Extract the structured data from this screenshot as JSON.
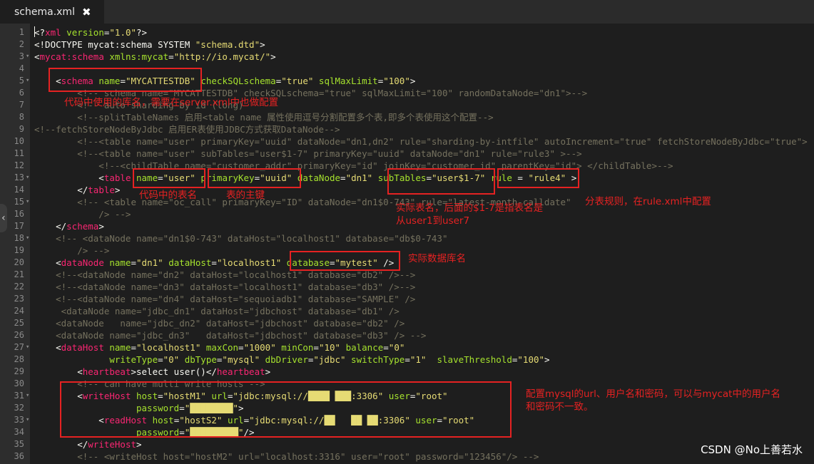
{
  "tab": {
    "title": "schema.xml",
    "close_icon": "close-icon"
  },
  "lines": [
    {
      "n": "1",
      "fold": "",
      "tokens": [
        [
          "t",
          "<?"
        ],
        [
          "tag",
          "xml"
        ],
        [
          "attr",
          " version"
        ],
        [
          "t",
          "="
        ],
        [
          "str",
          "\"1.0\""
        ],
        [
          "t",
          "?>"
        ]
      ]
    },
    {
      "n": "2",
      "fold": "",
      "tokens": [
        [
          "t",
          "<!DOCTYPE mycat:schema SYSTEM "
        ],
        [
          "str",
          "\"schema.dtd\""
        ],
        [
          "t",
          ">"
        ]
      ]
    },
    {
      "n": "3",
      "fold": "▾",
      "tokens": [
        [
          "t",
          "<"
        ],
        [
          "tag",
          "mycat:schema"
        ],
        [
          "attr",
          " xmlns:mycat"
        ],
        [
          "t",
          "="
        ],
        [
          "str",
          "\"http://io.mycat/\""
        ],
        [
          "t",
          ">"
        ]
      ]
    },
    {
      "n": "4",
      "fold": "",
      "tokens": []
    },
    {
      "n": "5",
      "fold": "▾",
      "tokens": [
        [
          "t",
          "    <"
        ],
        [
          "tag",
          "schema"
        ],
        [
          "attr",
          " name"
        ],
        [
          "t",
          "="
        ],
        [
          "str",
          "\"MYCATTESTDB\""
        ],
        [
          "attr",
          " checkSQLschema"
        ],
        [
          "t",
          "="
        ],
        [
          "str",
          "\"true\""
        ],
        [
          "attr",
          " sqlMaxLimit"
        ],
        [
          "t",
          "="
        ],
        [
          "str",
          "\"100\""
        ],
        [
          "t",
          ">"
        ]
      ]
    },
    {
      "n": "6",
      "fold": "",
      "tokens": [
        [
          "com",
          "        <!-- schema name=\"MYCATTESTDB\" checkSQLschema=\"true\" sqlMaxLimit=\"100\" randomDataNode=\"dn1\">-->"
        ]
      ]
    },
    {
      "n": "7",
      "fold": "",
      "tokens": [
        [
          "com",
          "        <!-- auto sharding by id (long)"
        ]
      ]
    },
    {
      "n": "8",
      "fold": "",
      "tokens": [
        [
          "com",
          "        <!--splitTableNames 启用<table name 属性使用逗号分割配置多个表,即多个表使用这个配置-->"
        ]
      ]
    },
    {
      "n": "9",
      "fold": "",
      "tokens": [
        [
          "com",
          "<!--fetchStoreNodeByJdbc 启用ER表使用JDBC方式获取DataNode-->"
        ]
      ]
    },
    {
      "n": "10",
      "fold": "",
      "tokens": [
        [
          "com",
          "        <!--<table name=\"user\" primaryKey=\"uuid\" dataNode=\"dn1,dn2\" rule=\"sharding-by-intfile\" autoIncrement=\"true\" fetchStoreNodeByJdbc=\"true\">"
        ]
      ]
    },
    {
      "n": "11",
      "fold": "",
      "tokens": [
        [
          "com",
          "        <!--<table name=\"user\" subTables=\"user$1-7\" primaryKey=\"uuid\" dataNode=\"dn1\" rule=\"rule3\" >-->"
        ]
      ]
    },
    {
      "n": "12",
      "fold": "",
      "tokens": [
        [
          "com",
          "            <!--<childTable name=\"customer_addr\" primaryKey=\"id\" joinKey=\"customer_id\" parentKey=\"id\"> </childTable>-->"
        ]
      ]
    },
    {
      "n": "13",
      "fold": "▾",
      "tokens": [
        [
          "t",
          "            <"
        ],
        [
          "tag",
          "table"
        ],
        [
          "attr",
          " name"
        ],
        [
          "t",
          "="
        ],
        [
          "str",
          "\"user\""
        ],
        [
          "attr",
          " primaryKey"
        ],
        [
          "t",
          "="
        ],
        [
          "str",
          "\"uuid\""
        ],
        [
          "attr",
          " dataNode"
        ],
        [
          "t",
          "="
        ],
        [
          "str",
          "\"dn1\""
        ],
        [
          "attr",
          " subTables"
        ],
        [
          "t",
          "="
        ],
        [
          "str",
          "\"user$1-7\""
        ],
        [
          "attr",
          " rule"
        ],
        [
          "t",
          " = "
        ],
        [
          "str",
          "\"rule4\""
        ],
        [
          "t",
          " >"
        ]
      ]
    },
    {
      "n": "14",
      "fold": "",
      "tokens": [
        [
          "t",
          "        </"
        ],
        [
          "tag",
          "table"
        ],
        [
          "t",
          ">"
        ]
      ]
    },
    {
      "n": "15",
      "fold": "▾",
      "tokens": [
        [
          "com",
          "        <!-- <table name=\"oc_call\" primaryKey=\"ID\" dataNode=\"dn1$0-743\" rule=\"latest-month-calldate\""
        ]
      ]
    },
    {
      "n": "16",
      "fold": "",
      "tokens": [
        [
          "com",
          "            /> -->"
        ]
      ]
    },
    {
      "n": "17",
      "fold": "",
      "tokens": [
        [
          "t",
          "    </"
        ],
        [
          "tag",
          "schema"
        ],
        [
          "t",
          ">"
        ]
      ]
    },
    {
      "n": "18",
      "fold": "▾",
      "tokens": [
        [
          "com",
          "    <!-- <dataNode name=\"dn1$0-743\" dataHost=\"localhost1\" database=\"db$0-743\""
        ]
      ]
    },
    {
      "n": "19",
      "fold": "",
      "tokens": [
        [
          "com",
          "        /> -->"
        ]
      ]
    },
    {
      "n": "20",
      "fold": "",
      "tokens": [
        [
          "t",
          "    <"
        ],
        [
          "tag",
          "dataNode"
        ],
        [
          "attr",
          " name"
        ],
        [
          "t",
          "="
        ],
        [
          "str",
          "\"dn1\""
        ],
        [
          "attr",
          " dataHost"
        ],
        [
          "t",
          "="
        ],
        [
          "str",
          "\"localhost1\""
        ],
        [
          "attr",
          " database"
        ],
        [
          "t",
          "="
        ],
        [
          "str",
          "\"mytest\""
        ],
        [
          "t",
          " />"
        ]
      ]
    },
    {
      "n": "21",
      "fold": "",
      "tokens": [
        [
          "com",
          "    <!--<dataNode name=\"dn2\" dataHost=\"localhost1\" database=\"db2\" />-->"
        ]
      ]
    },
    {
      "n": "22",
      "fold": "",
      "tokens": [
        [
          "com",
          "    <!--<dataNode name=\"dn3\" dataHost=\"localhost1\" database=\"db3\" />-->"
        ]
      ]
    },
    {
      "n": "23",
      "fold": "",
      "tokens": [
        [
          "com",
          "    <!--<dataNode name=\"dn4\" dataHost=\"sequoiadb1\" database=\"SAMPLE\" />"
        ]
      ]
    },
    {
      "n": "24",
      "fold": "",
      "tokens": [
        [
          "com",
          "     <dataNode name=\"jdbc_dn1\" dataHost=\"jdbchost\" database=\"db1\" />"
        ]
      ]
    },
    {
      "n": "25",
      "fold": "",
      "tokens": [
        [
          "com",
          "    <dataNode   name=\"jdbc_dn2\" dataHost=\"jdbchost\" database=\"db2\" />"
        ]
      ]
    },
    {
      "n": "26",
      "fold": "",
      "tokens": [
        [
          "com",
          "    <dataNode name=\"jdbc_dn3\"   dataHost=\"jdbchost\" database=\"db3\" /> -->"
        ]
      ]
    },
    {
      "n": "27",
      "fold": "▾",
      "tokens": [
        [
          "t",
          "    <"
        ],
        [
          "tag",
          "dataHost"
        ],
        [
          "attr",
          " name"
        ],
        [
          "t",
          "="
        ],
        [
          "str",
          "\"localhost1\""
        ],
        [
          "attr",
          " maxCon"
        ],
        [
          "t",
          "="
        ],
        [
          "str",
          "\"1000\""
        ],
        [
          "attr",
          " minCon"
        ],
        [
          "t",
          "="
        ],
        [
          "str",
          "\"10\""
        ],
        [
          "attr",
          " balance"
        ],
        [
          "t",
          "="
        ],
        [
          "str",
          "\"0\""
        ]
      ]
    },
    {
      "n": "28",
      "fold": "",
      "tokens": [
        [
          "attr",
          "              writeType"
        ],
        [
          "t",
          "="
        ],
        [
          "str",
          "\"0\""
        ],
        [
          "attr",
          " dbType"
        ],
        [
          "t",
          "="
        ],
        [
          "str",
          "\"mysql\""
        ],
        [
          "attr",
          " dbDriver"
        ],
        [
          "t",
          "="
        ],
        [
          "str",
          "\"jdbc\""
        ],
        [
          "attr",
          " switchType"
        ],
        [
          "t",
          "="
        ],
        [
          "str",
          "\"1\""
        ],
        [
          "attr",
          "  slaveThreshold"
        ],
        [
          "t",
          "="
        ],
        [
          "str",
          "\"100\""
        ],
        [
          "t",
          ">"
        ]
      ]
    },
    {
      "n": "29",
      "fold": "",
      "tokens": [
        [
          "t",
          "        <"
        ],
        [
          "tag",
          "heartbeat"
        ],
        [
          "t",
          ">select user()</"
        ],
        [
          "tag",
          "heartbeat"
        ],
        [
          "t",
          ">"
        ]
      ]
    },
    {
      "n": "30",
      "fold": "",
      "tokens": [
        [
          "com",
          "        <!-- can have multi write hosts -->"
        ]
      ]
    },
    {
      "n": "31",
      "fold": "▾",
      "tokens": [
        [
          "t",
          "        <"
        ],
        [
          "tag",
          "writeHost"
        ],
        [
          "attr",
          " host"
        ],
        [
          "t",
          "="
        ],
        [
          "str",
          "\"hostM1\""
        ],
        [
          "attr",
          " url"
        ],
        [
          "t",
          "="
        ],
        [
          "str",
          "\"jdbc:mysql://████ ███:3306\""
        ],
        [
          "attr",
          " user"
        ],
        [
          "t",
          "="
        ],
        [
          "str",
          "\"root\""
        ]
      ]
    },
    {
      "n": "32",
      "fold": "",
      "tokens": [
        [
          "attr",
          "                   password"
        ],
        [
          "t",
          "="
        ],
        [
          "str",
          "\"████████\""
        ],
        [
          "t",
          ">"
        ]
      ]
    },
    {
      "n": "33",
      "fold": "▾",
      "tokens": [
        [
          "t",
          "            <"
        ],
        [
          "tag",
          "readHost"
        ],
        [
          "attr",
          " host"
        ],
        [
          "t",
          "="
        ],
        [
          "str",
          "\"hostS2\""
        ],
        [
          "attr",
          " url"
        ],
        [
          "t",
          "="
        ],
        [
          "str",
          "\"jdbc:mysql://██   ██ ██:3306\""
        ],
        [
          "attr",
          " user"
        ],
        [
          "t",
          "="
        ],
        [
          "str",
          "\"root\""
        ]
      ]
    },
    {
      "n": "34",
      "fold": "",
      "tokens": [
        [
          "attr",
          "                   password"
        ],
        [
          "t",
          "="
        ],
        [
          "str",
          "\"█████████\""
        ],
        [
          "t",
          "/>"
        ]
      ]
    },
    {
      "n": "35",
      "fold": "",
      "tokens": [
        [
          "t",
          "        </"
        ],
        [
          "tag",
          "writeHost"
        ],
        [
          "t",
          ">"
        ]
      ]
    },
    {
      "n": "36",
      "fold": "",
      "tokens": [
        [
          "com",
          "        <!-- <writeHost host=\"hostM2\" url=\"localhost:3316\" user=\"root\" password=\"123456\"/> -->"
        ]
      ]
    }
  ],
  "annotations": {
    "schema_name": "代码中使用的库名，需要在server.xml中也做配置",
    "table_name": "代码中的表名",
    "primary_key": "表的主键",
    "sub_tables": "实际表名，后面的$1-7是指表名是\n从user1到user7",
    "rule": "分表规则，在rule.xml中配置",
    "database": "实际数据库名",
    "hosts": "配置mysql的url、用户名和密码，可以与mycat中的用户名\n和密码不一致。"
  },
  "watermark": "CSDN @No上善若水",
  "colors": {
    "tag": "#f92672",
    "attr": "#a6e22e",
    "string": "#e6db74",
    "comment": "#75715e",
    "annotation": "#e52222"
  }
}
